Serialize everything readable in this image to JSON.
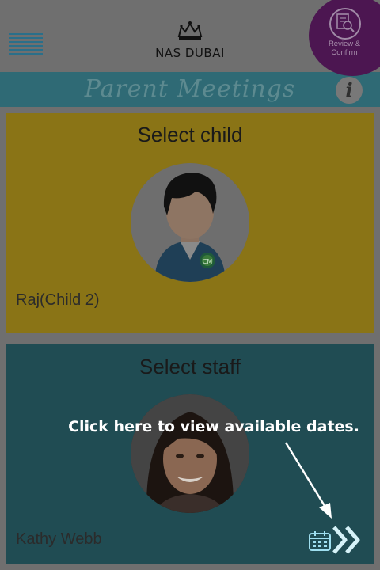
{
  "header": {
    "logo_text": "NAS DUBAI",
    "title": "Parent Meetings"
  },
  "child_card": {
    "title": "Select child",
    "name": "Raj(Child 2)",
    "badge_text": "CM"
  },
  "review": {
    "label_line1": "Review &",
    "label_line2": "Confirm"
  },
  "staff_card": {
    "title": "Select staff",
    "name": "Kathy Webb"
  },
  "tooltip": {
    "text": "Click here to view available dates."
  },
  "colors": {
    "overlay_bg": "#6f6f6f",
    "title_bar": "#2f6a75",
    "child_card": "#8a7416",
    "staff_card": "#204c53",
    "review_badge": "#4c1651",
    "accent_blue": "#2a6f8a",
    "highlight": "#d6f2f8"
  },
  "icons": {
    "menu": "hamburger-icon",
    "settings": "gear-icon",
    "info": "info-icon",
    "review": "magnifier-document-icon",
    "calendar": "calendar-icon",
    "next": "double-chevron-right-icon"
  }
}
